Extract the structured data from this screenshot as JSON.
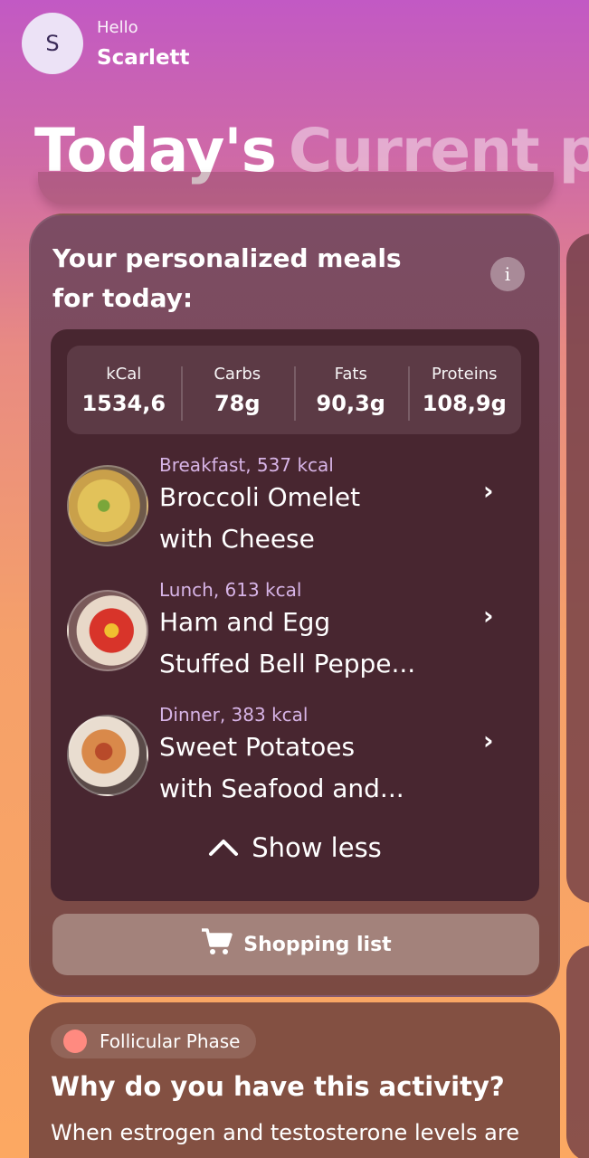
{
  "header": {
    "avatar_initial": "S",
    "greeting": "Hello",
    "user_name": "Scarlett"
  },
  "title": {
    "part1": "Today's",
    "part2": "Current ph"
  },
  "meals_card": {
    "title": "Your personalized meals for today:",
    "info_icon": "i",
    "macros": [
      {
        "label": "kCal",
        "value": "1534,6"
      },
      {
        "label": "Carbs",
        "value": "78g"
      },
      {
        "label": "Fats",
        "value": "90,3g"
      },
      {
        "label": "Proteins",
        "value": "108,9g"
      }
    ],
    "meals": [
      {
        "sub": "Breakfast, 537 kcal",
        "line1": "Broccoli Omelet",
        "line2": "with Cheese",
        "icon": "broccoli-omelet-photo"
      },
      {
        "sub": "Lunch, 613 kcal",
        "line1": "Ham and Egg",
        "line2": "Stuffed Bell Peppe...",
        "icon": "stuffed-pepper-photo"
      },
      {
        "sub": "Dinner, 383 kcal",
        "line1": "Sweet Potatoes",
        "line2": "with Seafood and...",
        "icon": "sweet-potato-seafood-photo"
      }
    ],
    "chevron": "›",
    "show_less": "Show less",
    "shopping_list": "Shopping list"
  },
  "phase_card": {
    "badge": "Follicular Phase",
    "question": "Why do you have this activity?",
    "text": "When estrogen and testosterone levels are"
  },
  "colors": {
    "accent_dot": "#ff8a80",
    "inner_panel": "#482630",
    "meal_sub": "#d7b4e6"
  }
}
